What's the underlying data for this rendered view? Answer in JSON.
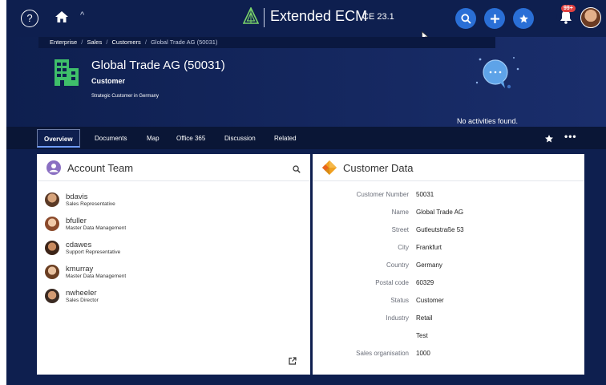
{
  "topbar": {
    "help_label": "?",
    "product_name": "Extended ECM",
    "version": "CE 23.1",
    "notification_badge": "99+"
  },
  "breadcrumb": [
    "Enterprise",
    "Sales",
    "Customers",
    "Global Trade AG (50031)"
  ],
  "header": {
    "title": "Global Trade AG (50031)",
    "type": "Customer",
    "description": "Strategic Customer in Germany",
    "no_activities": "No activities found."
  },
  "tabs": [
    {
      "label": "Overview",
      "active": true
    },
    {
      "label": "Documents"
    },
    {
      "label": "Map"
    },
    {
      "label": "Office 365"
    },
    {
      "label": "Discussion"
    },
    {
      "label": "Related"
    }
  ],
  "tab_more": "•••",
  "account_team": {
    "title": "Account Team",
    "members": [
      {
        "name": "bdavis",
        "role": "Sales Representative"
      },
      {
        "name": "bfuller",
        "role": "Master Data Management"
      },
      {
        "name": "cdawes",
        "role": "Support Representative"
      },
      {
        "name": "kmurray",
        "role": "Master Data Management"
      },
      {
        "name": "nwheeler",
        "role": "Sales Director"
      }
    ]
  },
  "customer_data": {
    "title": "Customer Data",
    "rows": [
      {
        "label": "Customer Number",
        "value": "50031"
      },
      {
        "label": "Name",
        "value": "Global Trade AG"
      },
      {
        "label": "Street",
        "value": "Gutleutstraße 53"
      },
      {
        "label": "City",
        "value": "Frankfurt"
      },
      {
        "label": "Country",
        "value": "Germany"
      },
      {
        "label": "Postal code",
        "value": "60329"
      },
      {
        "label": "Status",
        "value": "Customer"
      },
      {
        "label": "Industry",
        "value": "Retail"
      },
      {
        "label": "",
        "value": "Test"
      },
      {
        "label": "Sales organisation",
        "value": "1000"
      }
    ]
  },
  "icons": {
    "help": "help-icon",
    "home": "home-icon",
    "search": "search-icon",
    "add": "add-icon",
    "favorites": "star-icon",
    "notifications": "bell-icon",
    "building": "building-icon",
    "activity": "chat-bubble-icon",
    "open_external": "open-external-icon"
  },
  "colors": {
    "navy": "#0e1f4f",
    "accent_blue": "#2a6fd6",
    "badge_red": "#e04141",
    "building_green": "#3fbf6a",
    "customer_orange": "#f0a020"
  }
}
